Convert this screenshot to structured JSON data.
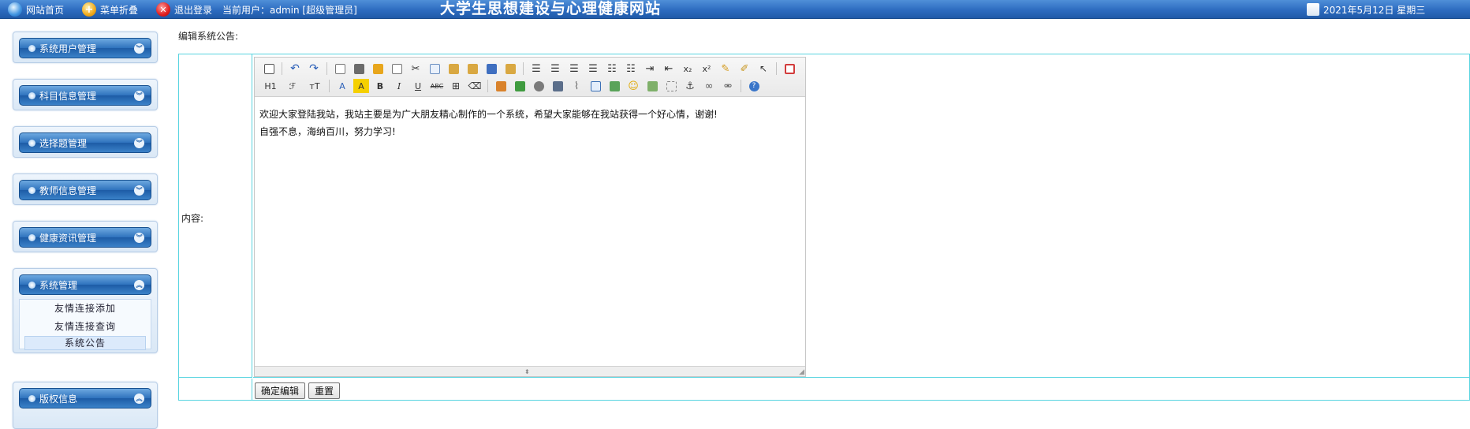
{
  "topbar": {
    "home_label": "网站首页",
    "fold_label": "菜单折叠",
    "logout_label": "退出登录",
    "current_user_label": "当前用户：admin [超级管理员]",
    "site_title": "大学生思想建设与心理健康网站",
    "date_text": "2021年5月12日 星期三"
  },
  "sidebar": {
    "menus": [
      {
        "label": "系统用户管理"
      },
      {
        "label": "科目信息管理"
      },
      {
        "label": "选择题管理"
      },
      {
        "label": "教师信息管理"
      },
      {
        "label": "健康资讯管理"
      },
      {
        "label": "系统管理",
        "items": [
          "友情连接添加",
          "友情连接查询",
          "系统公告"
        ]
      },
      {
        "label": "版权信息"
      }
    ]
  },
  "main": {
    "title": "编辑系统公告:",
    "content_label": "内容:",
    "editor": {
      "line1": "欢迎大家登陆我站，我站主要是为广大朋友精心制作的一个系统，希望大家能够在我站获得一个好心情，谢谢!",
      "line2": "自强不息，海纳百川，努力学习!",
      "toolbar_text": {
        "heading": "H1",
        "font": "ℱ",
        "size": "тT",
        "font_color": "A",
        "bg_color": "A",
        "bold": "B",
        "italic": "I",
        "underline": "U",
        "strike": "ABC",
        "subscript": "x₂",
        "superscript": "x²"
      }
    },
    "submit_label": "确定编辑",
    "reset_label": "重置"
  },
  "colors": {
    "topbar": "#2d6cc0",
    "table_border": "#58d4e0",
    "menu_head": "#2e72bd"
  }
}
